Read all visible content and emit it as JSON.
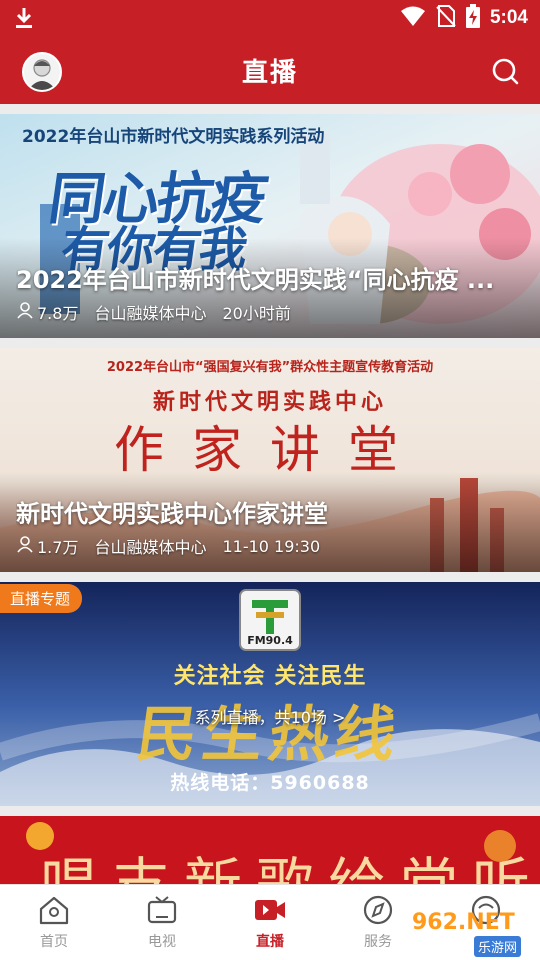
{
  "status_bar": {
    "time": "5:04"
  },
  "header": {
    "title": "直播"
  },
  "cards": [
    {
      "banner_heading": "2022年台山市新时代文明实践系列活动",
      "banner_slogan_1": "同心抗疫",
      "banner_slogan_2": "有你有我",
      "title": "2022年台山市新时代文明实践“同心抗疫 ...",
      "views": "7.8万",
      "source": "台山融媒体中心",
      "time": "20小时前"
    },
    {
      "banner_heading": "2022年台山市“强国复兴有我”群众性主题宣传教育活动",
      "banner_sub": "新时代文明实践中心",
      "banner_main": "作家讲堂",
      "title": "新时代文明实践中心作家讲堂",
      "views": "1.7万",
      "source": "台山融媒体中心",
      "time": "11-10 19:30"
    },
    {
      "badge": "直播专题",
      "logo_text": "FM90.4",
      "banner_tagline": "关注社会 关注民生",
      "banner_main": "民生热线",
      "series_link": "系列直播，共10场 >",
      "hotline": "热线电话：5960688"
    },
    {
      "banner_main": "唱支新歌给党听"
    }
  ],
  "bottom_nav": [
    {
      "label": "首页",
      "icon": "home-icon"
    },
    {
      "label": "电视",
      "icon": "tv-icon"
    },
    {
      "label": "直播",
      "icon": "live-video-icon",
      "active": true
    },
    {
      "label": "服务",
      "icon": "compass-icon"
    },
    {
      "label": "",
      "icon": "mine-icon"
    }
  ],
  "watermark": {
    "brand": "962.NET",
    "site": "乐游网"
  },
  "colors": {
    "brand": "#c71f26",
    "badge": "#f07a1b",
    "nav_inactive": "#999999"
  }
}
